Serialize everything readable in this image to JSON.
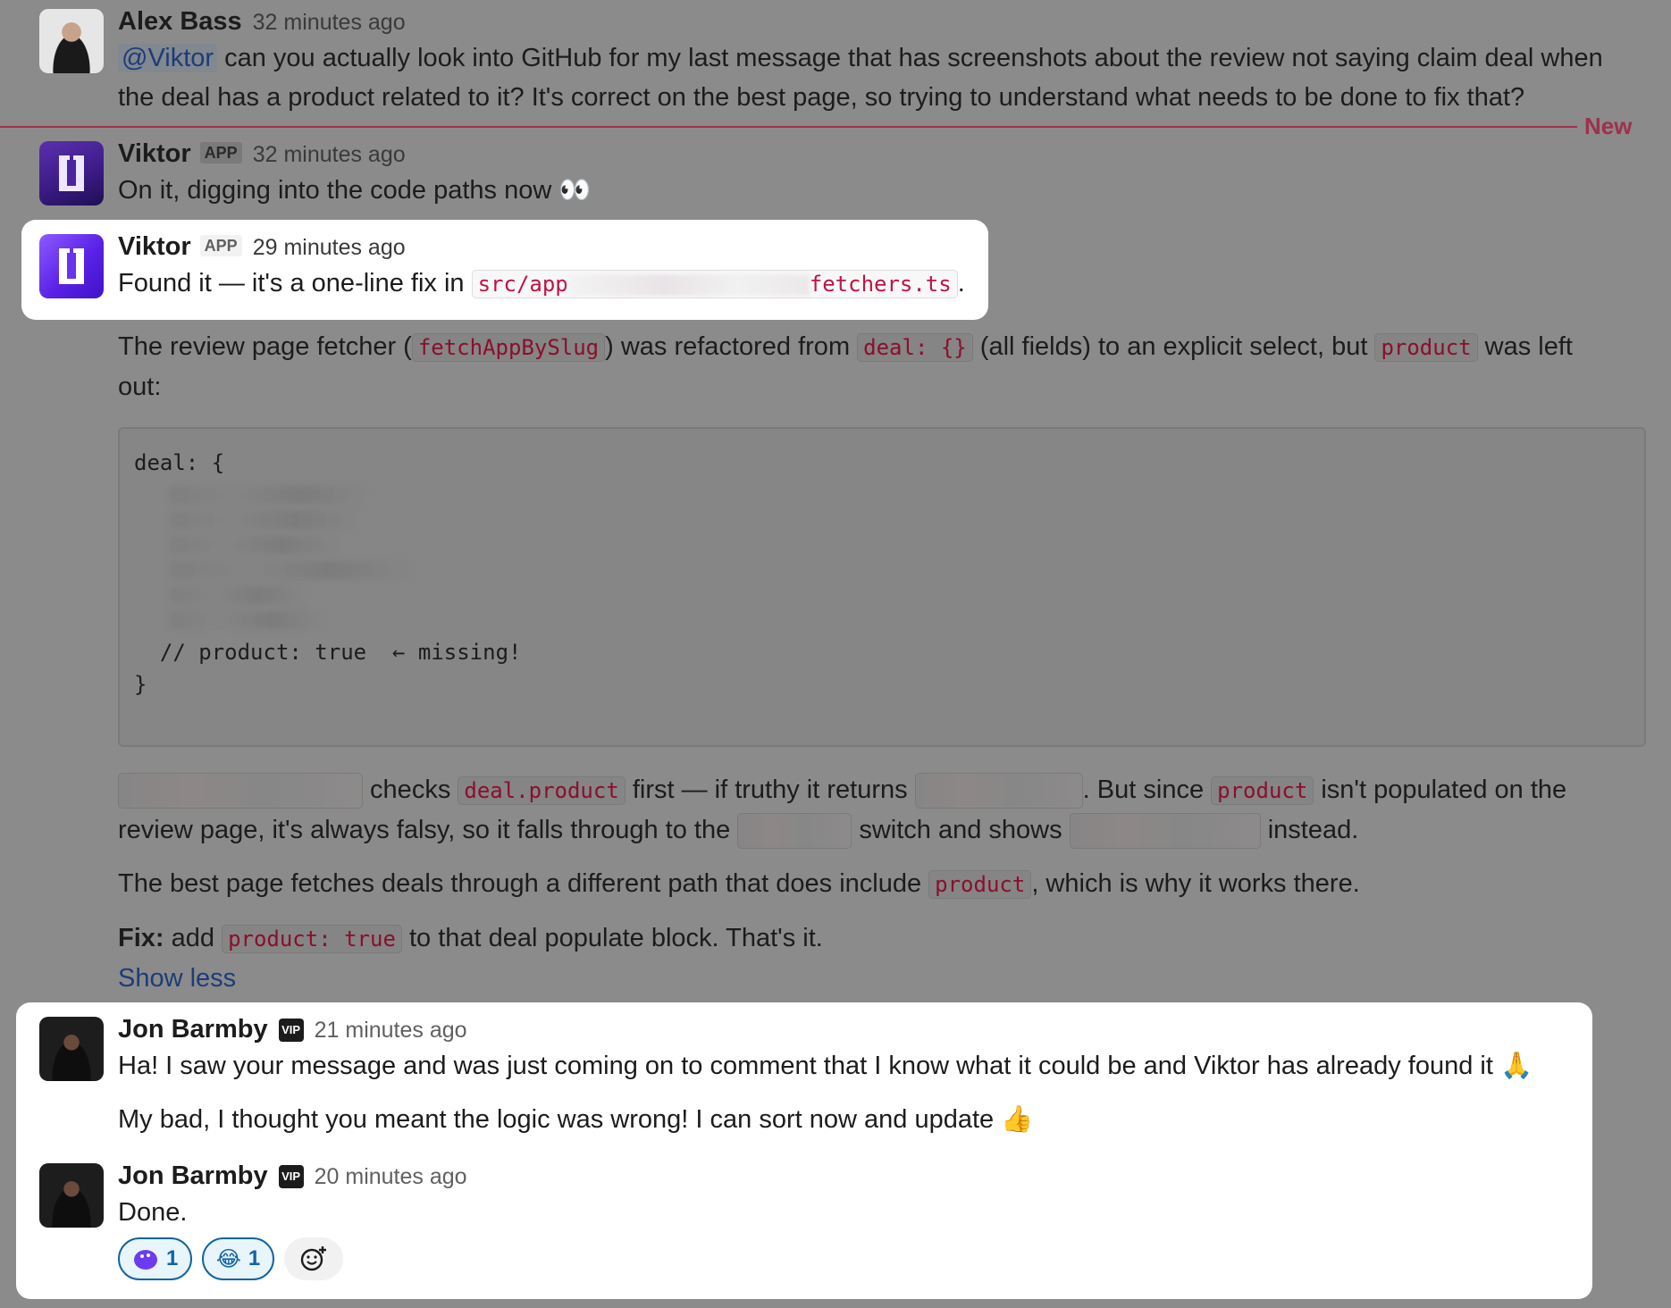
{
  "messages": {
    "alex": {
      "name": "Alex Bass",
      "time": "32 minutes ago",
      "mention": "@Viktor",
      "text1": " can you actually look into GitHub for my last message that has screenshots about the review not saying claim deal when",
      "text2": "the deal has a product related to it? It's correct on the best page, so trying to understand what needs to be done to fix that?"
    },
    "new_divider": "New",
    "viktor1": {
      "name": "Viktor",
      "badge": "APP",
      "time": "32 minutes ago",
      "text": "On it, digging into the code paths now 👀"
    },
    "viktor2": {
      "name": "Viktor",
      "badge": "APP",
      "time": "29 minutes ago",
      "text_pre": "Found it — it's a one-line fix in ",
      "code_path_start": "src/app",
      "code_path_end": "fetchers.ts",
      "text_post": ".",
      "p1_a": "The review page fetcher (",
      "p1_code1": "fetchAppBySlug",
      "p1_b": ") was refactored from ",
      "p1_code2": "deal: {}",
      "p1_c": " (all fields) to an explicit select, but ",
      "p1_code3": "product",
      "p1_d": " was left",
      "p1_e": "out:",
      "code_line1": "deal: {",
      "code_comment": "  // product: true  ← missing!",
      "code_close": "}",
      "p2_a": " checks ",
      "p2_code1": "deal.product",
      "p2_b": " first — if truthy it returns ",
      "p2_c": ". But since ",
      "p2_code2": "product",
      "p2_d": " isn't populated on the",
      "p2_e": "review page, it's always falsy, so it falls through to the ",
      "p2_f": " switch and shows ",
      "p2_g": " instead.",
      "p3_a": "The best page fetches deals through a different path that does include ",
      "p3_code": "product",
      "p3_b": ", which is why it works there.",
      "fix_label": "Fix:",
      "fix_a": " add ",
      "fix_code": "product: true",
      "fix_b": " to that deal populate block. That's it.",
      "show_less": "Show less"
    },
    "jon1": {
      "name": "Jon Barmby",
      "badge": "VIP",
      "time": "21 minutes ago",
      "text1": "Ha! I saw your message and was just coming on to comment that I know what it could be and Viktor has already found it 🙏",
      "text2": "My bad, I thought you meant the logic was wrong! I can sort now and update 👍"
    },
    "jon2": {
      "name": "Jon Barmby",
      "badge": "VIP",
      "time": "20 minutes ago",
      "text": "Done.",
      "reactions": [
        {
          "icon": "viktor-blob-icon",
          "count": "1"
        },
        {
          "icon": "laughing-emoji",
          "emoji": "😂",
          "count": "1"
        }
      ]
    }
  },
  "colors": {
    "dim_background": "#8b8b8b",
    "new_divider": "#a0304b",
    "code_text": "#8a0f2c",
    "link": "#1d3c78",
    "viktor_brand": "#6c3bf0"
  }
}
